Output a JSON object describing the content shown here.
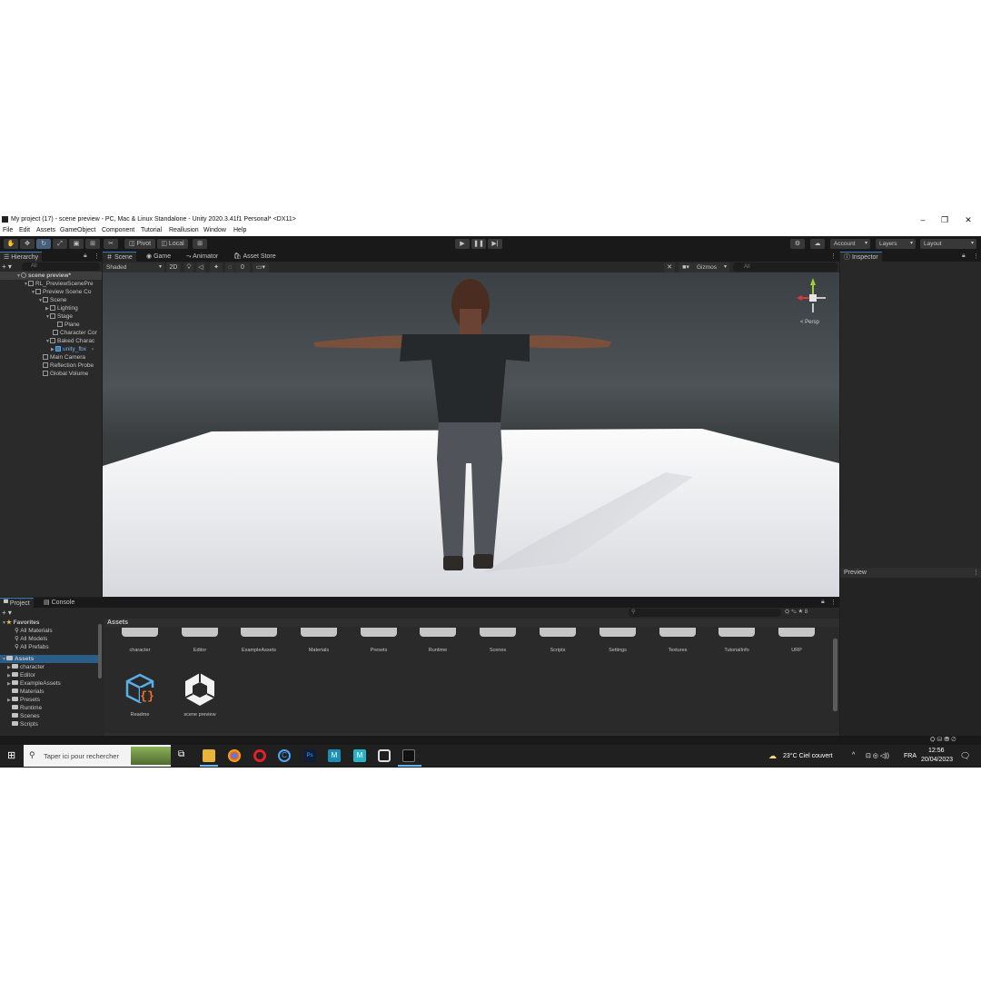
{
  "window": {
    "title": "My project (17) - scene preview - PC, Mac & Linux Standalone - Unity 2020.3.41f1 Personal* <DX11>"
  },
  "menu": [
    "File",
    "Edit",
    "Assets",
    "GameObject",
    "Component",
    "Tutorial",
    "Reallusion",
    "Window",
    "Help"
  ],
  "toolbar": {
    "pivot_label": "Pivot",
    "local_label": "Local",
    "account_label": "Account",
    "layers_label": "Layers",
    "layout_label": "Layout"
  },
  "hierarchy": {
    "tab_label": "Hierarchy",
    "search_placeholder": "All",
    "items": [
      {
        "label": "scene preview*",
        "depth": 0
      },
      {
        "label": "RL_PreviewScenePre",
        "depth": 1
      },
      {
        "label": "Preview Scene Co",
        "depth": 2
      },
      {
        "label": "Scene",
        "depth": 3
      },
      {
        "label": "Lighting",
        "depth": 4
      },
      {
        "label": "Stage",
        "depth": 4
      },
      {
        "label": "Plane",
        "depth": 5
      },
      {
        "label": "Character Cor",
        "depth": 4
      },
      {
        "label": "Baked Charac",
        "depth": 4
      },
      {
        "label": "unity_fbx",
        "depth": 5
      },
      {
        "label": "Main Camera",
        "depth": 3
      },
      {
        "label": "Reflection Probe",
        "depth": 3
      },
      {
        "label": "Global Volume",
        "depth": 3
      }
    ]
  },
  "scene": {
    "tabs": [
      "Scene",
      "Game",
      "Animator",
      "Asset Store"
    ],
    "shading_mode": "Shaded",
    "mode_2d_label": "2D",
    "gizmos_label": "Gizmos",
    "search_placeholder": "All",
    "persp_label": "< Persp"
  },
  "inspector": {
    "tab_label": "Inspector",
    "preview_label": "Preview"
  },
  "project": {
    "tabs": [
      "Project",
      "Console"
    ],
    "breadcrumb": "Assets",
    "favorites_label": "Favorites",
    "favorites": [
      "All Materials",
      "All Models",
      "All Prefabs"
    ],
    "assets_root_label": "Assets",
    "asset_tree": [
      "character",
      "Editor",
      "ExampleAssets",
      "Materials",
      "Presets",
      "Runtime",
      "Scenes",
      "Scripts"
    ],
    "folders": [
      "character",
      "Editor",
      "ExampleAssets",
      "Materials",
      "Presets",
      "Runtime",
      "Scenes",
      "Scripts",
      "Settings",
      "Textures",
      "TutorialInfo",
      "URP"
    ],
    "files": [
      "Readme",
      "scene preview"
    ],
    "badge_count": "8"
  },
  "taskbar": {
    "search_placeholder": "Taper ici pour rechercher",
    "weather": "23°C  Ciel couvert",
    "language": "FRA",
    "time": "12:56",
    "date": "20/04/2023"
  },
  "colors": {
    "editor_bg": "#282828",
    "selection": "#2c5d87",
    "accent": "#3a79bb"
  }
}
